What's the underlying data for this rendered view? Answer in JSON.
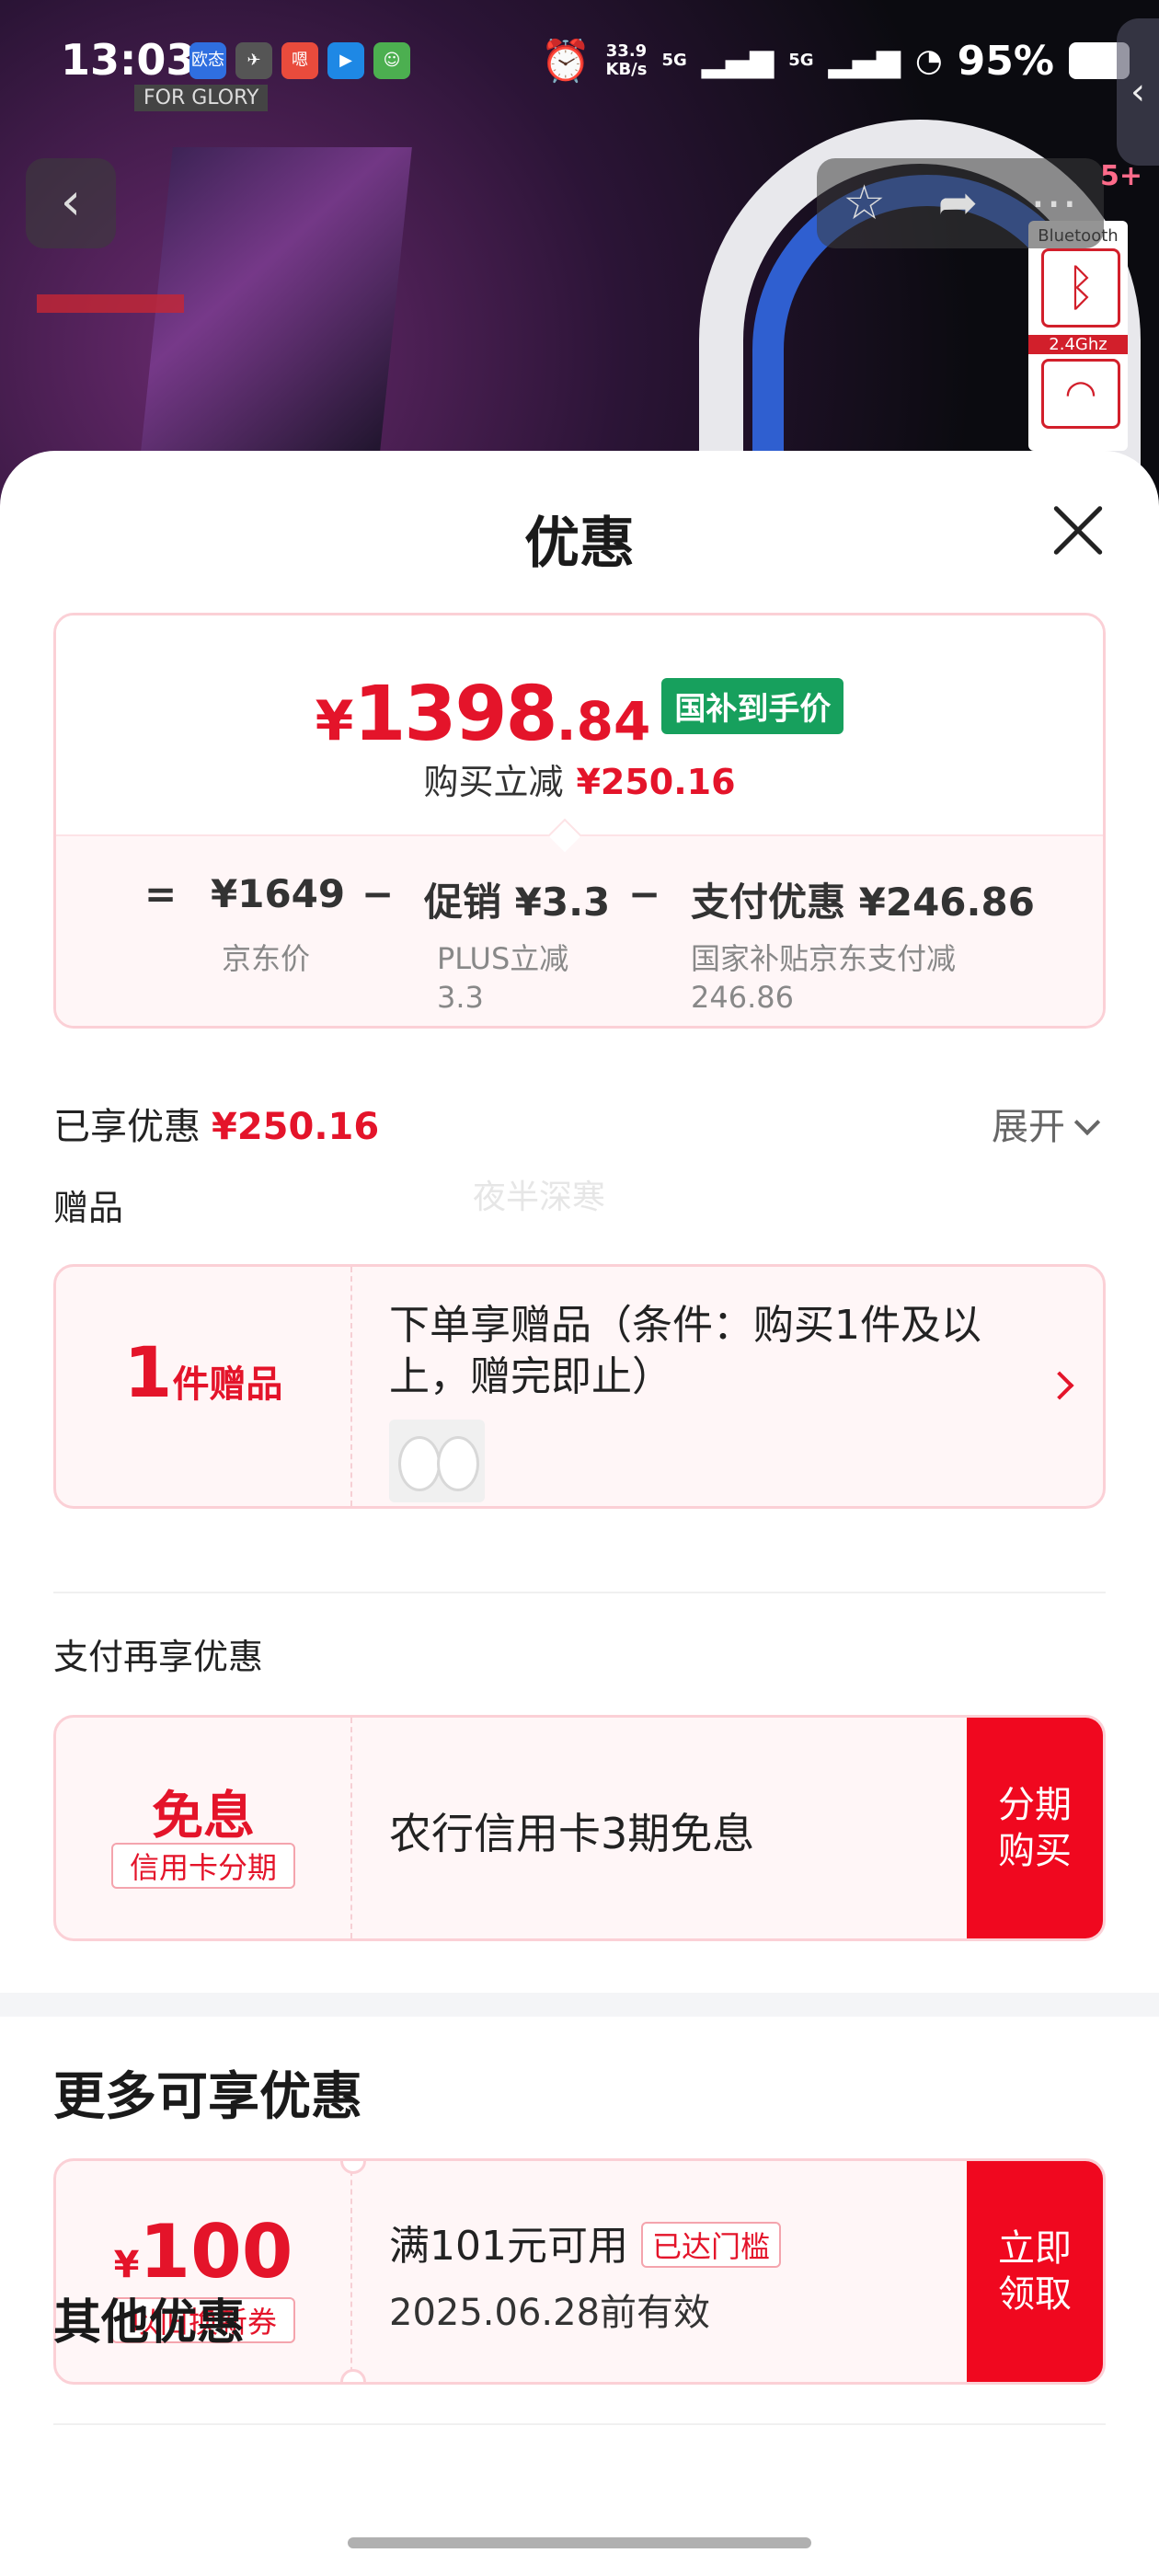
{
  "status_bar": {
    "time": "13:03",
    "net_speed_value": "33.9",
    "net_speed_unit": "KB/s",
    "sim1": "5G",
    "sim2": "5G",
    "battery": "95%",
    "app_icons": [
      "欧态",
      "game-icon",
      "嗯",
      "video-icon",
      "avatar-icon"
    ],
    "overlay_text": "FOR GLORY"
  },
  "product_nav": {
    "back_icon": "chevron-left-icon",
    "favorite_icon": "star-outline-icon",
    "share_icon": "share-icon",
    "more_icon": "more-dots-icon",
    "count_badge": "5+"
  },
  "hero_badge": {
    "bluetooth_label": "Bluetooth",
    "ghz_label": "2.4Ghz"
  },
  "sheet": {
    "title": "优惠",
    "price": {
      "yen": "¥",
      "integer": "1398",
      "decimal": ".84",
      "tag": "国补到手价",
      "reduce_label": "购买立减",
      "reduce_value": "¥250.16"
    },
    "calc": {
      "equals": "=",
      "base_price": "¥1649",
      "base_label": "京东价",
      "minus1": "−",
      "promo": "促销 ¥3.3",
      "promo_label_1": "PLUS立减",
      "promo_label_2": "3.3",
      "minus2": "−",
      "pay_discount": "支付优惠 ¥246.86",
      "pay_label_1": "国家补贴京东支付减",
      "pay_label_2": "246.86"
    },
    "enjoyed": {
      "label": "已享优惠",
      "value": "¥250.16",
      "expand": "展开"
    },
    "gift_section": "赠品",
    "watermark": "夜半深寒",
    "gift": {
      "count": "1",
      "unit": "件赠品",
      "title": "下单享赠品（条件：购买1件及以上，赠完即止）"
    },
    "pay_section": "支付再享优惠",
    "pay_offer": {
      "big": "免息",
      "small": "信用卡分期",
      "text": "农行信用卡3期免息",
      "button_line1": "分期",
      "button_line2": "购买"
    },
    "more_title": "更多可享优惠",
    "coupon": {
      "yen": "¥",
      "amount": "100",
      "tag": "以旧换新券",
      "condition": "满101元可用",
      "badge": "已达门槛",
      "valid": "2025.06.28前有效",
      "button_line1": "立即",
      "button_line2": "领取"
    },
    "other_title": "其他优惠"
  },
  "colors": {
    "accent_red": "#e4142a",
    "button_red": "#f0081f",
    "tag_green": "#17a05d",
    "card_border": "#fbd0d6",
    "card_bg": "#fff6f7"
  }
}
